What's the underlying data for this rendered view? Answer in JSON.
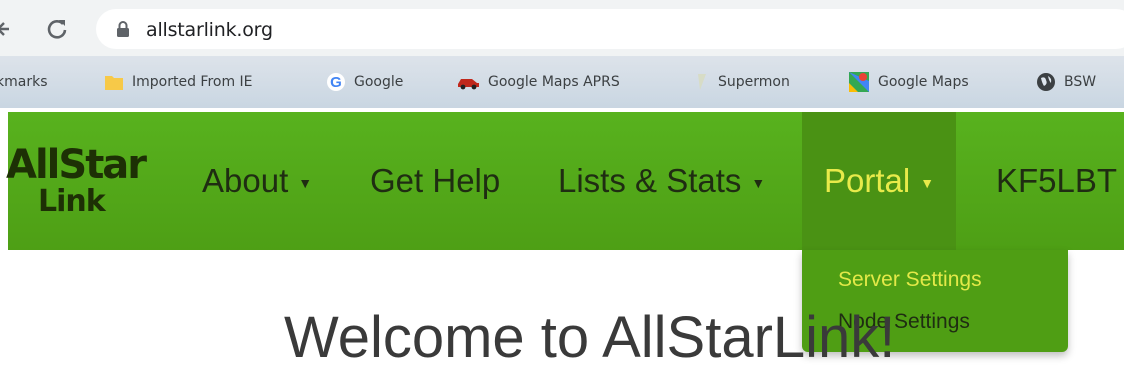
{
  "browser": {
    "url": "allstarlink.org"
  },
  "bookmarks": {
    "items": [
      {
        "label": "kmarks",
        "icon": "bookmarks-icon"
      },
      {
        "label": "Imported From IE",
        "icon": "folder-icon"
      },
      {
        "label": "Google",
        "icon": "google-icon"
      },
      {
        "label": "Google Maps APRS",
        "icon": "car-icon"
      },
      {
        "label": "Supermon",
        "icon": "supermon-icon"
      },
      {
        "label": "Google Maps",
        "icon": "maps-icon"
      },
      {
        "label": "BSW",
        "icon": "globe-icon"
      }
    ]
  },
  "site": {
    "logo_line1": "AllStar",
    "logo_line2": "Link",
    "nav": {
      "about": "About",
      "get_help": "Get Help",
      "lists_stats": "Lists & Stats",
      "portal": "Portal",
      "user": "KF5LBT"
    },
    "portal_menu": {
      "server_settings": "Server Settings",
      "node_settings": "Node Settings"
    },
    "welcome": "Welcome to AllStarLink!"
  },
  "colors": {
    "nav_green": "#58b21e",
    "active_yellow": "#e8ea4a"
  }
}
